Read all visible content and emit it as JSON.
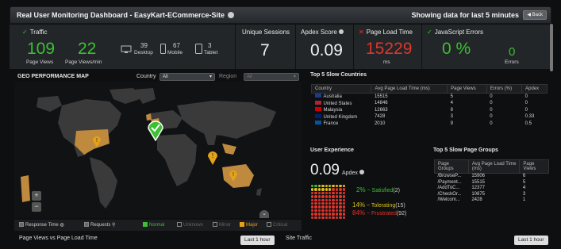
{
  "title": {
    "left": "Real User Monitoring Dashboard - EasyKart-ECommerce-Site",
    "right": "Showing data for last 5 minutes",
    "back": "Back"
  },
  "traffic": {
    "label": "Traffic",
    "page_views": "109",
    "page_views_label": "Page Views",
    "per_min": "22",
    "per_min_label": "Page Views/min",
    "desktop": "39",
    "desktop_label": "Desktop",
    "mobile": "67",
    "mobile_label": "Mobile",
    "tablet": "3",
    "tablet_label": "Tablet"
  },
  "sessions": {
    "label": "Unique Sessions",
    "value": "7"
  },
  "apdex": {
    "label": "Apdex Score",
    "value": "0.09"
  },
  "load_time": {
    "label": "Page Load Time",
    "value": "15229",
    "unit": "ms"
  },
  "js_errors": {
    "label": "JavaScript Errors",
    "value": "0 %",
    "count": "0",
    "count_label": "Errors"
  },
  "geo": {
    "title": "GEO PERFORMANCE MAP",
    "country_label": "Country",
    "country_value": "All",
    "region_label": "Region",
    "region_value": "All"
  },
  "legend": {
    "response_time": "Response Time",
    "requests": "Requests",
    "normal": "Normal",
    "unknown": "Unknown",
    "minor": "Minor",
    "major": "Major",
    "critical": "Critical"
  },
  "slow_countries": {
    "title": "Top 5 Slow Countries",
    "headers": [
      "Country",
      "Avg Page Load Time (ms)",
      "Page Views",
      "Errors (%)",
      "Apdex"
    ],
    "rows": [
      {
        "country": "Australia",
        "time": "15515",
        "views": "5",
        "errors": "0",
        "apdex": "0",
        "flag": "#1a3a8a"
      },
      {
        "country": "United States",
        "time": "14846",
        "views": "4",
        "errors": "0",
        "apdex": "0",
        "flag": "#b22234"
      },
      {
        "country": "Malaysia",
        "time": "12663",
        "views": "8",
        "errors": "0",
        "apdex": "0",
        "flag": "#cc0001"
      },
      {
        "country": "United Kingdom",
        "time": "7428",
        "views": "3",
        "errors": "0",
        "apdex": "0.33",
        "flag": "#012169"
      },
      {
        "country": "France",
        "time": "2010",
        "views": "9",
        "errors": "0",
        "apdex": "0.5",
        "flag": "#0055a4"
      }
    ]
  },
  "user_exp": {
    "title": "User Experience",
    "apdex": "0.09",
    "apdex_label": "Apdex",
    "satisfied_pct": "2%",
    "satisfied_label": "Satisfied",
    "satisfied_count": "(2)",
    "tolerating_pct": "14%",
    "tolerating_label": "Tolerating",
    "tolerating_count": "(15)",
    "frustrated_pct": "84%",
    "frustrated_label": "Frustrated",
    "frustrated_count": "(92)",
    "dot_counts": {
      "satisfied": 2,
      "tolerating": 14,
      "frustrated": 84
    }
  },
  "slow_pages": {
    "title": "Top 5 Slow Page Groups",
    "headers": [
      "Page Groups",
      "Avg Page Load Time (ms)",
      "Page Views"
    ],
    "rows": [
      {
        "group": "/BrowseP...",
        "time": "15906",
        "views": "6"
      },
      {
        "group": "/Payment...",
        "time": "15515",
        "views": "5"
      },
      {
        "group": "/AddToC...",
        "time": "12377",
        "views": "4"
      },
      {
        "group": "/CheckOr...",
        "time": "10875",
        "views": "3"
      },
      {
        "group": "/Welcom...",
        "time": "2428",
        "views": "1"
      }
    ]
  },
  "bottom": {
    "left_label": "Page Views vs Page Load Time",
    "left_btn": "Last 1 hour",
    "right_label": "Site Traffic",
    "right_btn": "Last 1 hour"
  },
  "colors": {
    "green": "#3cbf33",
    "red": "#e0352b",
    "amber": "#e3a21a",
    "yellow": "#d9c21c"
  }
}
